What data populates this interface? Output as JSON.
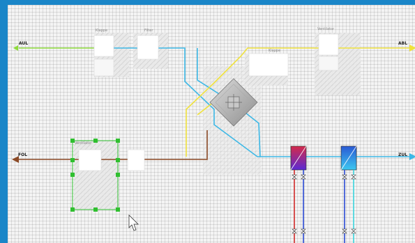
{
  "ports": {
    "aul": "AUL",
    "abl": "ABL",
    "fol": "FOL",
    "zul": "ZUL"
  },
  "components": {
    "klappe_top": "Klappe",
    "filter": "Filter",
    "ventilator_top": "Ventilator",
    "klappe_right": "Klappe",
    "ventilator_left": "Ventilator"
  },
  "colors": {
    "outdoor_air": "#8fdc3c",
    "supply_air": "#3cb8e6",
    "exhaust_air": "#f0e23c",
    "extract_air": "#8b4a26",
    "selection": "#2fbf2f",
    "hot_water": "#d42a2a",
    "cold_water": "#2a4ad4",
    "cooling_return": "#3cd8e0"
  },
  "selection": {
    "component": "ventilator_left"
  }
}
